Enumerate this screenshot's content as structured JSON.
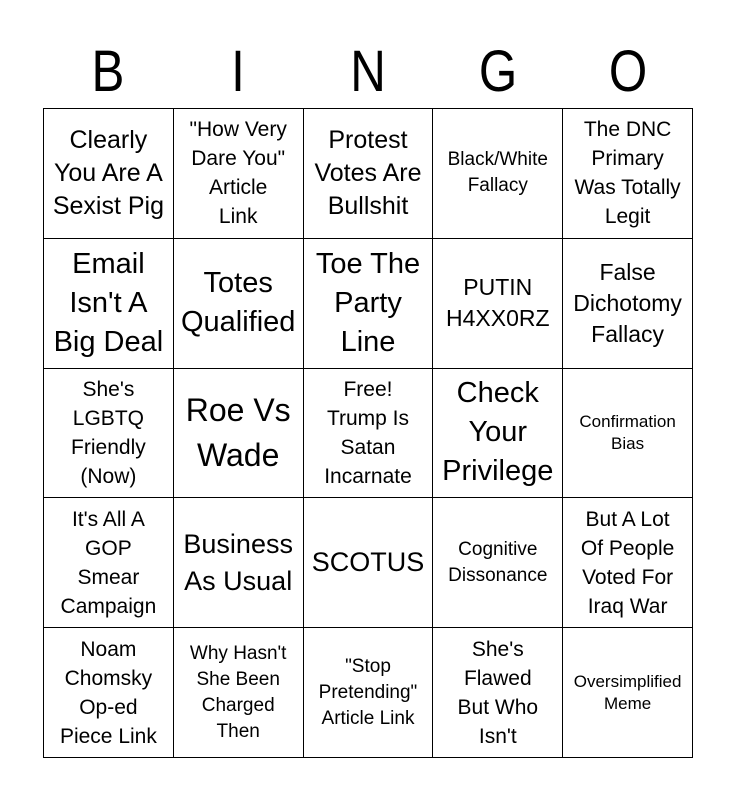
{
  "header": {
    "letters": [
      "B",
      "I",
      "N",
      "G",
      "O"
    ]
  },
  "card": {
    "rows": [
      [
        {
          "text": "Clearly\nYou Are A\nSexist Pig"
        },
        {
          "text": "\"How Very\nDare You\"\nArticle\nLink"
        },
        {
          "text": "Protest\nVotes Are\nBullshit"
        },
        {
          "text": "Black/White\nFallacy"
        },
        {
          "text": "The DNC\nPrimary\nWas Totally\nLegit"
        }
      ],
      [
        {
          "text": "Email\nIsn't A\nBig Deal"
        },
        {
          "text": "Totes\nQualified"
        },
        {
          "text": "Toe The\nParty\nLine"
        },
        {
          "text": "PUTIN\nH4XX0RZ"
        },
        {
          "text": "False\nDichotomy\nFallacy"
        }
      ],
      [
        {
          "text": "She's\nLGBTQ\nFriendly\n(Now)"
        },
        {
          "text": "Roe Vs\nWade"
        },
        {
          "text": "Free!\nTrump Is\nSatan\nIncarnate"
        },
        {
          "text": "Check\nYour\nPrivilege"
        },
        {
          "text": "Confirmation\nBias"
        }
      ],
      [
        {
          "text": "It's All A\nGOP\nSmear\nCampaign"
        },
        {
          "text": "Business\nAs Usual"
        },
        {
          "text": "SCOTUS"
        },
        {
          "text": "Cognitive\nDissonance"
        },
        {
          "text": "But A Lot\nOf People\nVoted For\nIraq War"
        }
      ],
      [
        {
          "text": "Noam\nChomsky\nOp-ed\nPiece Link"
        },
        {
          "text": "Why Hasn't\nShe Been\nCharged\nThen"
        },
        {
          "text": "\"Stop\nPretending\"\nArticle Link"
        },
        {
          "text": "She's\nFlawed\nBut Who\nIsn't"
        },
        {
          "text": "Oversimplified\nMeme"
        }
      ]
    ]
  }
}
